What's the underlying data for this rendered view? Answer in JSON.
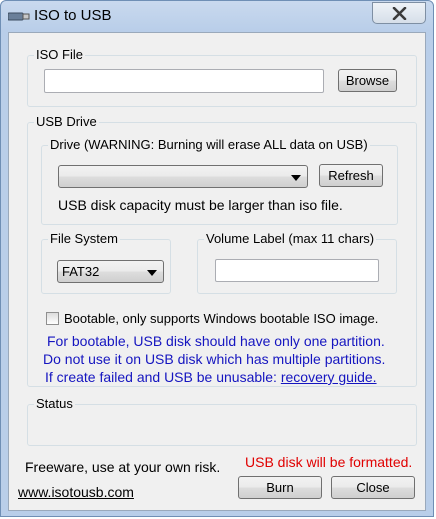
{
  "window": {
    "title": "ISO to USB"
  },
  "iso_file": {
    "legend": "ISO File",
    "path_value": "",
    "browse_label": "Browse"
  },
  "usb_drive": {
    "legend": "USB Drive",
    "drive_legend": "Drive (WARNING: Burning will erase ALL data on USB)",
    "drive_value": "",
    "refresh_label": "Refresh",
    "capacity_note": "USB disk capacity must be larger than iso file.",
    "file_system": {
      "legend": "File System",
      "value": "FAT32"
    },
    "volume_label": {
      "legend": "Volume Label (max 11 chars)",
      "value": ""
    },
    "bootable_label": "Bootable, only supports Windows bootable ISO image.",
    "bootable_checked": false,
    "notes": [
      "For bootable, USB disk should have only one partition.",
      "Do not use it on USB disk which has multiple partitions."
    ],
    "recovery_prefix": "If create failed and USB be unusable: ",
    "recovery_link": "recovery guide."
  },
  "status": {
    "legend": "Status",
    "text": ""
  },
  "footer": {
    "freeware": "Freeware, use at your own risk.",
    "warning": "USB disk will be formatted.",
    "website": "www.isotousb.com",
    "burn_label": "Burn",
    "close_label": "Close"
  },
  "colors": {
    "note_blue": "#1515c0",
    "warning_red": "#e00000",
    "title_bar": "#b9cee9"
  }
}
